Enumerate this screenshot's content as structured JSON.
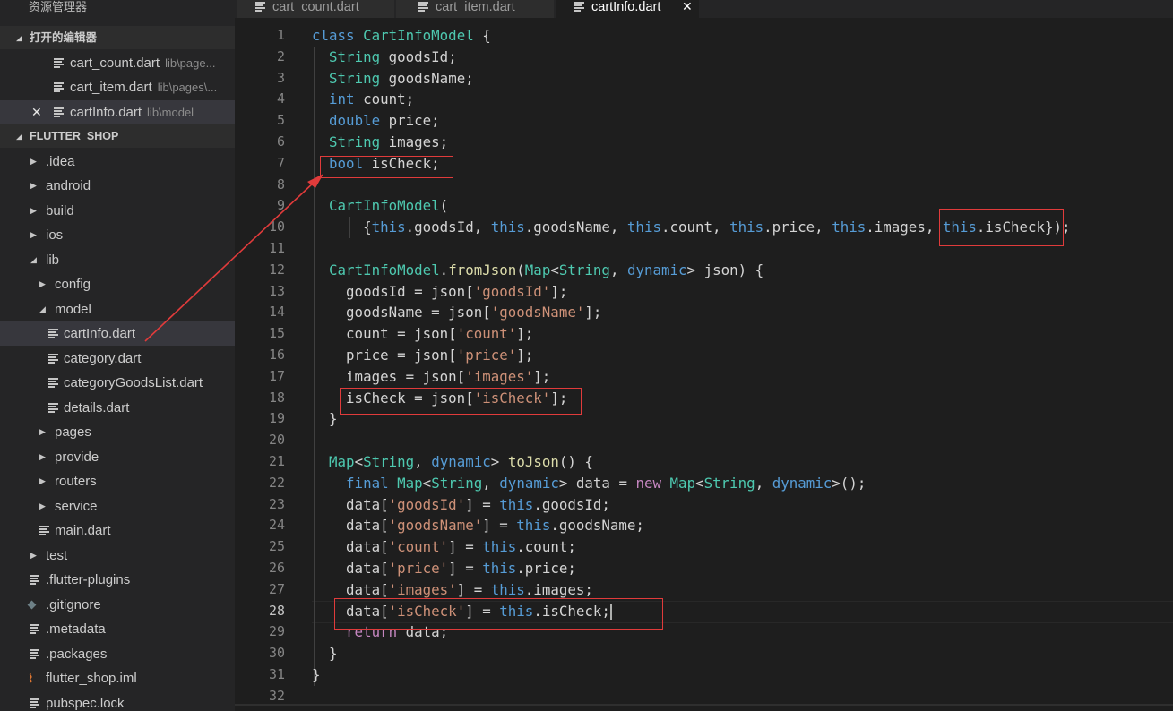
{
  "sidebar": {
    "title": "资源管理器",
    "open_editors_header": "打开的编辑器",
    "open_editors": [
      {
        "name": "cart_count.dart",
        "path": "lib\\page..."
      },
      {
        "name": "cart_item.dart",
        "path": "lib\\pages\\..."
      },
      {
        "name": "cartInfo.dart",
        "path": "lib\\model"
      }
    ],
    "project_header": "FLUTTER_SHOP",
    "tree": [
      {
        "label": ".idea"
      },
      {
        "label": "android"
      },
      {
        "label": "build"
      },
      {
        "label": "ios"
      },
      {
        "label": "lib"
      },
      {
        "label": "config"
      },
      {
        "label": "model"
      },
      {
        "label": "cartInfo.dart"
      },
      {
        "label": "category.dart"
      },
      {
        "label": "categoryGoodsList.dart"
      },
      {
        "label": "details.dart"
      },
      {
        "label": "pages"
      },
      {
        "label": "provide"
      },
      {
        "label": "routers"
      },
      {
        "label": "service"
      },
      {
        "label": "main.dart"
      },
      {
        "label": "test"
      },
      {
        "label": ".flutter-plugins"
      },
      {
        "label": ".gitignore"
      },
      {
        "label": ".metadata"
      },
      {
        "label": ".packages"
      },
      {
        "label": "flutter_shop.iml"
      },
      {
        "label": "pubspec.lock"
      }
    ]
  },
  "tabs": [
    {
      "label": "cart_count.dart",
      "active": false
    },
    {
      "label": "cart_item.dart",
      "active": false
    },
    {
      "label": "cartInfo.dart",
      "active": true
    }
  ],
  "editor": {
    "current_line": 28,
    "lines": [
      [
        [
          "k",
          "class"
        ],
        [
          "p",
          " "
        ],
        [
          "t",
          "CartInfoModel"
        ],
        [
          "p",
          " {"
        ]
      ],
      [
        [
          "p",
          "  "
        ],
        [
          "t",
          "String"
        ],
        [
          "p",
          " goodsId;"
        ]
      ],
      [
        [
          "p",
          "  "
        ],
        [
          "t",
          "String"
        ],
        [
          "p",
          " goodsName;"
        ]
      ],
      [
        [
          "p",
          "  "
        ],
        [
          "k",
          "int"
        ],
        [
          "p",
          " count;"
        ]
      ],
      [
        [
          "p",
          "  "
        ],
        [
          "k",
          "double"
        ],
        [
          "p",
          " price;"
        ]
      ],
      [
        [
          "p",
          "  "
        ],
        [
          "t",
          "String"
        ],
        [
          "p",
          " images;"
        ]
      ],
      [
        [
          "p",
          "  "
        ],
        [
          "k",
          "bool"
        ],
        [
          "p",
          " isCheck;"
        ]
      ],
      [],
      [
        [
          "p",
          "  "
        ],
        [
          "t",
          "CartInfoModel"
        ],
        [
          "p",
          "("
        ]
      ],
      [
        [
          "p",
          "      {"
        ],
        [
          "k",
          "this"
        ],
        [
          "p",
          ".goodsId, "
        ],
        [
          "k",
          "this"
        ],
        [
          "p",
          ".goodsName, "
        ],
        [
          "k",
          "this"
        ],
        [
          "p",
          ".count, "
        ],
        [
          "k",
          "this"
        ],
        [
          "p",
          ".price, "
        ],
        [
          "k",
          "this"
        ],
        [
          "p",
          ".images, "
        ],
        [
          "k",
          "this"
        ],
        [
          "p",
          ".isCheck});"
        ]
      ],
      [],
      [
        [
          "p",
          "  "
        ],
        [
          "t",
          "CartInfoModel"
        ],
        [
          "p",
          "."
        ],
        [
          "f",
          "fromJson"
        ],
        [
          "p",
          "("
        ],
        [
          "t",
          "Map"
        ],
        [
          "p",
          "<"
        ],
        [
          "t",
          "String"
        ],
        [
          "p",
          ", "
        ],
        [
          "k",
          "dynamic"
        ],
        [
          "p",
          "> json) {"
        ]
      ],
      [
        [
          "p",
          "    goodsId = json["
        ],
        [
          "s",
          "'goodsId'"
        ],
        [
          "p",
          "];"
        ]
      ],
      [
        [
          "p",
          "    goodsName = json["
        ],
        [
          "s",
          "'goodsName'"
        ],
        [
          "p",
          "];"
        ]
      ],
      [
        [
          "p",
          "    count = json["
        ],
        [
          "s",
          "'count'"
        ],
        [
          "p",
          "];"
        ]
      ],
      [
        [
          "p",
          "    price = json["
        ],
        [
          "s",
          "'price'"
        ],
        [
          "p",
          "];"
        ]
      ],
      [
        [
          "p",
          "    images = json["
        ],
        [
          "s",
          "'images'"
        ],
        [
          "p",
          "];"
        ]
      ],
      [
        [
          "p",
          "    isCheck = json["
        ],
        [
          "s",
          "'isCheck'"
        ],
        [
          "p",
          "];"
        ]
      ],
      [
        [
          "p",
          "  }"
        ]
      ],
      [],
      [
        [
          "p",
          "  "
        ],
        [
          "t",
          "Map"
        ],
        [
          "p",
          "<"
        ],
        [
          "t",
          "String"
        ],
        [
          "p",
          ", "
        ],
        [
          "k",
          "dynamic"
        ],
        [
          "p",
          "> "
        ],
        [
          "f",
          "toJson"
        ],
        [
          "p",
          "() {"
        ]
      ],
      [
        [
          "p",
          "    "
        ],
        [
          "k",
          "final"
        ],
        [
          "p",
          " "
        ],
        [
          "t",
          "Map"
        ],
        [
          "p",
          "<"
        ],
        [
          "t",
          "String"
        ],
        [
          "p",
          ", "
        ],
        [
          "k",
          "dynamic"
        ],
        [
          "p",
          "> data = "
        ],
        [
          "c",
          "new"
        ],
        [
          "p",
          " "
        ],
        [
          "t",
          "Map"
        ],
        [
          "p",
          "<"
        ],
        [
          "t",
          "String"
        ],
        [
          "p",
          ", "
        ],
        [
          "k",
          "dynamic"
        ],
        [
          "p",
          ">();"
        ]
      ],
      [
        [
          "p",
          "    data["
        ],
        [
          "s",
          "'goodsId'"
        ],
        [
          "p",
          "] = "
        ],
        [
          "k",
          "this"
        ],
        [
          "p",
          ".goodsId;"
        ]
      ],
      [
        [
          "p",
          "    data["
        ],
        [
          "s",
          "'goodsName'"
        ],
        [
          "p",
          "] = "
        ],
        [
          "k",
          "this"
        ],
        [
          "p",
          ".goodsName;"
        ]
      ],
      [
        [
          "p",
          "    data["
        ],
        [
          "s",
          "'count'"
        ],
        [
          "p",
          "] = "
        ],
        [
          "k",
          "this"
        ],
        [
          "p",
          ".count;"
        ]
      ],
      [
        [
          "p",
          "    data["
        ],
        [
          "s",
          "'price'"
        ],
        [
          "p",
          "] = "
        ],
        [
          "k",
          "this"
        ],
        [
          "p",
          ".price;"
        ]
      ],
      [
        [
          "p",
          "    data["
        ],
        [
          "s",
          "'images'"
        ],
        [
          "p",
          "] = "
        ],
        [
          "k",
          "this"
        ],
        [
          "p",
          ".images;"
        ]
      ],
      [
        [
          "p",
          "    data["
        ],
        [
          "s",
          "'isCheck'"
        ],
        [
          "p",
          "] = "
        ],
        [
          "k",
          "this"
        ],
        [
          "p",
          ".isCheck;"
        ]
      ],
      [
        [
          "p",
          "    "
        ],
        [
          "c",
          "return"
        ],
        [
          "p",
          " data;"
        ]
      ],
      [
        [
          "p",
          "  }"
        ]
      ],
      [
        [
          "p",
          "}"
        ]
      ],
      []
    ]
  },
  "colors": {
    "keyword": "#569cd6",
    "type": "#4ec9b0",
    "string": "#ce9178",
    "function": "#dcdcaa",
    "control": "#c586c0",
    "annotation": "#e03b3b"
  }
}
